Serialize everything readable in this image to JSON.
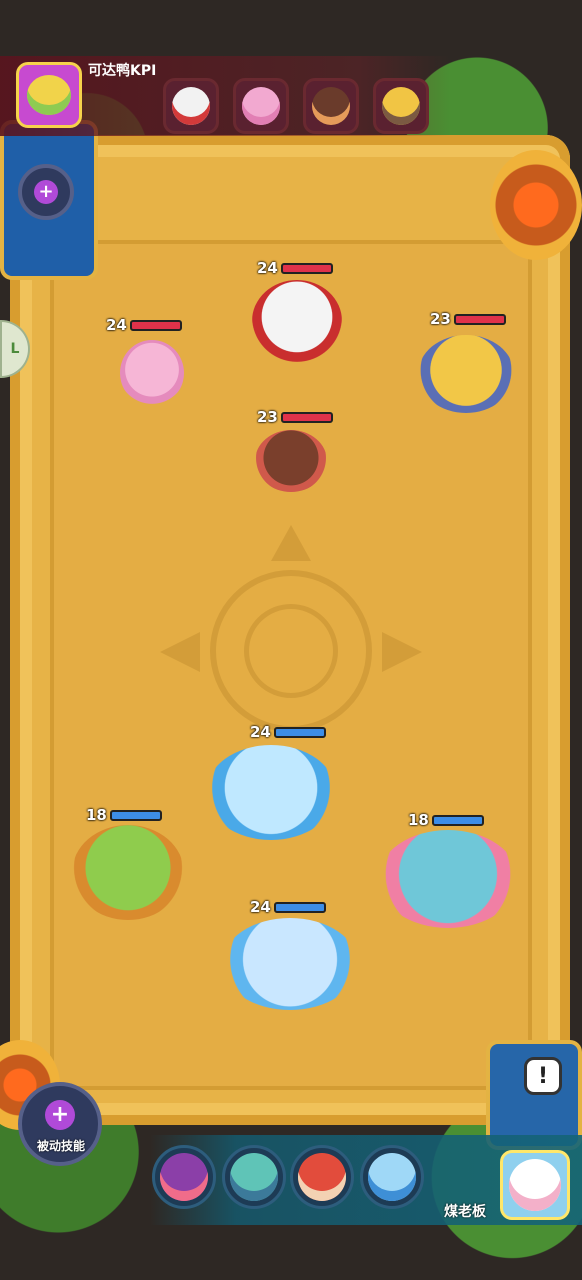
{
  "opponent": {
    "name": "可达鸭KPI",
    "portraits": [
      {
        "name": "white-red-horned-hero",
        "color": "#f2f2f2",
        "accent": "#d33a3a"
      },
      {
        "name": "pink-cat-hero",
        "color": "#f2a9d0",
        "accent": "#e27fb4"
      },
      {
        "name": "tribal-girl-hero",
        "color": "#6a3b2b",
        "accent": "#e59b5a"
      },
      {
        "name": "helmet-knight-hero",
        "color": "#f1c544",
        "accent": "#7b5a42"
      }
    ]
  },
  "enemy_units": [
    {
      "name": "white-monkey-warrior",
      "level": "24",
      "hp_fraction": 1.0,
      "color": "#f4f4f4",
      "accent": "#c92e2e"
    },
    {
      "name": "pink-cat-girl",
      "level": "24",
      "hp_fraction": 1.0,
      "color": "#f6b6d6",
      "accent": "#e58bbd"
    },
    {
      "name": "helmet-knight",
      "level": "23",
      "hp_fraction": 1.0,
      "color": "#f2c747",
      "accent": "#5a6fb5"
    },
    {
      "name": "tribal-spear-girl",
      "level": "23",
      "hp_fraction": 1.0,
      "color": "#7a3f2c",
      "accent": "#d0594b"
    }
  ],
  "ally_units": [
    {
      "name": "ice-swordsman",
      "level": "24",
      "hp_fraction": 1.0,
      "color": "#bfe8ff",
      "accent": "#4aa9e8"
    },
    {
      "name": "plant-jester",
      "level": "18",
      "hp_fraction": 1.0,
      "color": "#8fcc4d",
      "accent": "#d98b2e"
    },
    {
      "name": "shark-cook",
      "level": "18",
      "hp_fraction": 1.0,
      "color": "#6fc7d8",
      "accent": "#f07fa4"
    },
    {
      "name": "ice-queen",
      "level": "24",
      "hp_fraction": 1.0,
      "color": "#c9e7ff",
      "accent": "#5fb6ef"
    }
  ],
  "hand": [
    {
      "name": "purple-radish-hero",
      "color": "#8b3fa8",
      "accent": "#f06c8a"
    },
    {
      "name": "teal-mermaid-hero",
      "color": "#5fc4b7",
      "accent": "#3c7a9a"
    },
    {
      "name": "red-fox-hero",
      "color": "#e24c3c",
      "accent": "#f3d2b3"
    },
    {
      "name": "ice-swordsman-hero",
      "color": "#9fd8f7",
      "accent": "#3e8fd6"
    }
  ],
  "player": {
    "name": "煤老板",
    "avatar_color": "#a8dcf3"
  },
  "buttons": {
    "passive_skill_label": "被动技能",
    "alert_symbol": "!",
    "side_tab_symbol": "L"
  },
  "colors": {
    "arena": "#e7b347",
    "enemy_hp": "#e0324a",
    "ally_hp": "#3d8de6"
  }
}
